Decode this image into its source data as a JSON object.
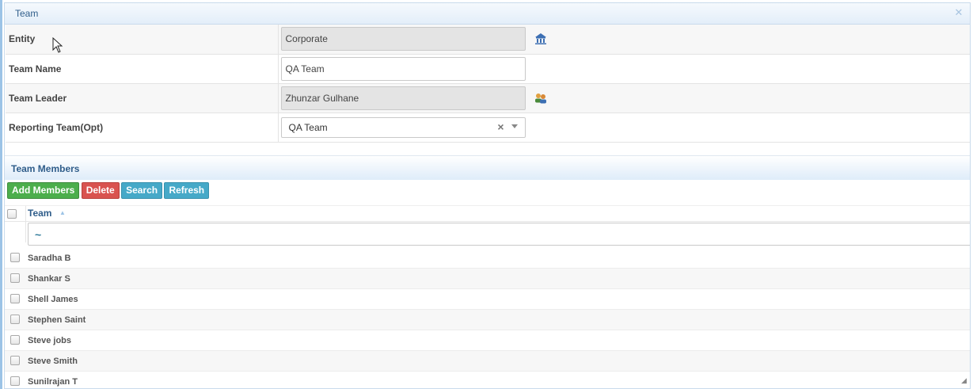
{
  "dialog": {
    "title": "Team"
  },
  "form": {
    "entity": {
      "label": "Entity",
      "value": "Corporate"
    },
    "team_name": {
      "label": "Team Name",
      "value": "QA Team"
    },
    "team_leader": {
      "label": "Team Leader",
      "value": "Zhunzar Gulhane"
    },
    "reporting_team": {
      "label": "Reporting Team(Opt)",
      "value": "QA Team"
    }
  },
  "members": {
    "title": "Team Members",
    "toolbar": {
      "add": "Add Members",
      "delete": "Delete",
      "search": "Search",
      "refresh": "Refresh"
    },
    "column": "Team",
    "filter_symbol": "~",
    "rows": [
      "Saradha B",
      "Shankar S",
      "Shell James",
      "Stephen Saint",
      "Steve jobs",
      "Steve Smith",
      "Sunilrajan T"
    ]
  },
  "icons": {
    "entity": "bank-icon",
    "leader": "users-icon",
    "close": "close-icon"
  },
  "colors": {
    "title": "#2f5d8a",
    "add_button": "#4cae4c",
    "delete_button": "#d9534f",
    "search_button": "#46a9c8",
    "readonly_field": "#e4e4e4"
  }
}
